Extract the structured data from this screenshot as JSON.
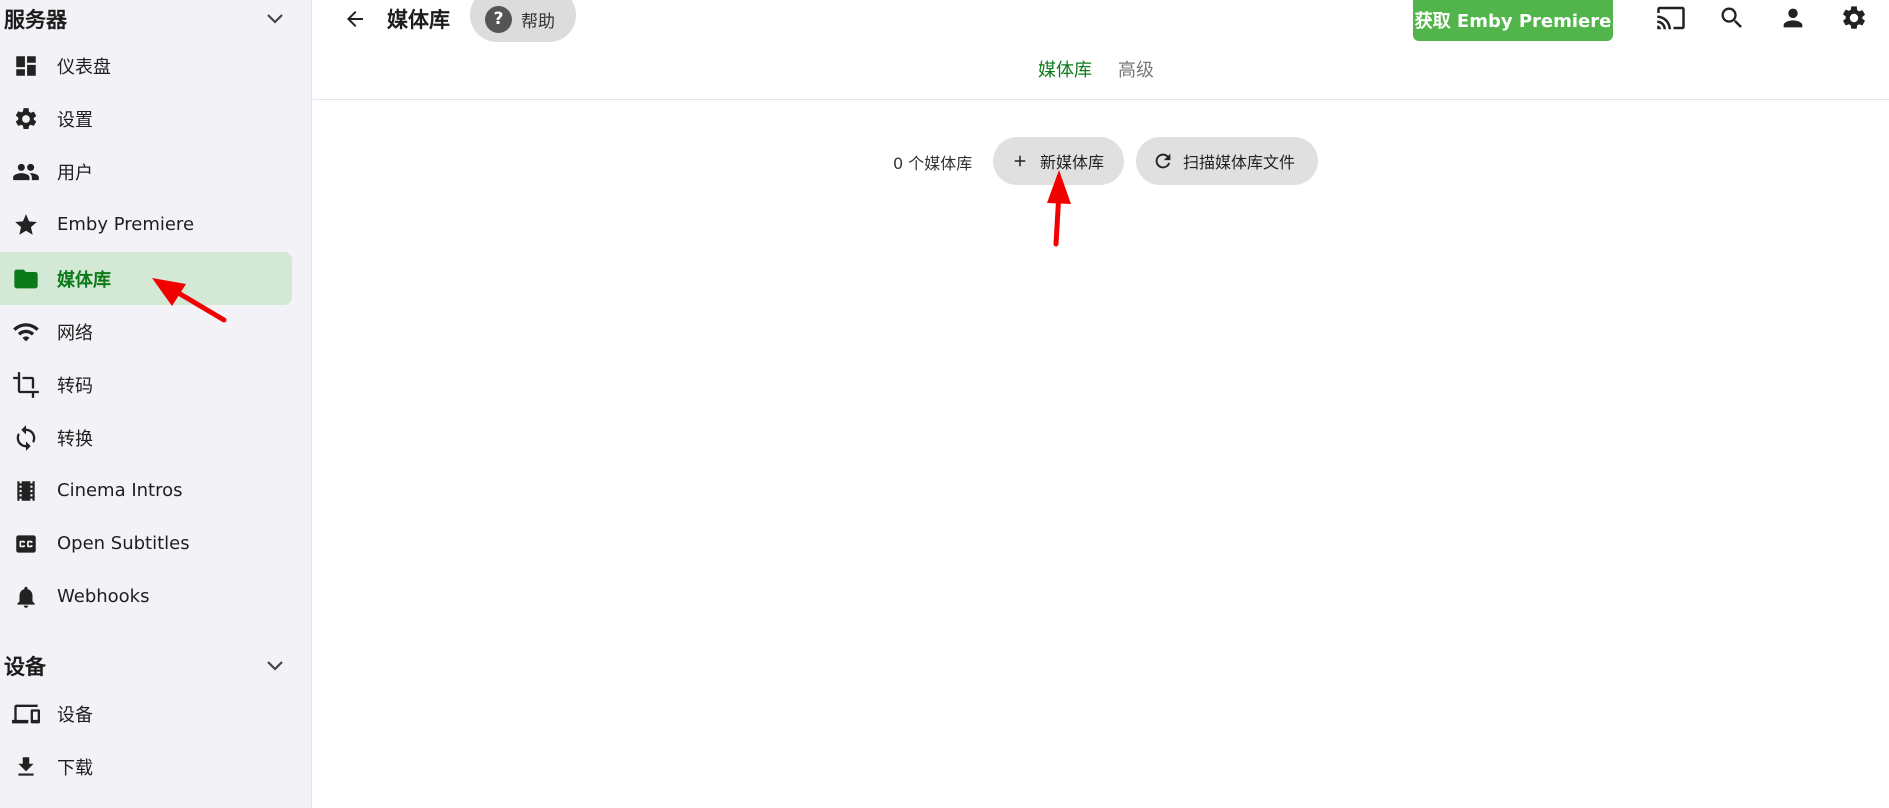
{
  "sidebar": {
    "sections": [
      {
        "title": "服务器",
        "items": [
          {
            "label": "仪表盘",
            "icon": "dashboard-icon"
          },
          {
            "label": "设置",
            "icon": "gear-icon"
          },
          {
            "label": "用户",
            "icon": "people-icon"
          },
          {
            "label": "Emby Premiere",
            "icon": "star-icon"
          },
          {
            "label": "媒体库",
            "icon": "folder-icon",
            "active": true
          },
          {
            "label": "网络",
            "icon": "wifi-icon"
          },
          {
            "label": "转码",
            "icon": "crop-icon"
          },
          {
            "label": "转换",
            "icon": "sync-icon"
          },
          {
            "label": "Cinema Intros",
            "icon": "film-icon"
          },
          {
            "label": "Open Subtitles",
            "icon": "cc-icon"
          },
          {
            "label": "Webhooks",
            "icon": "bell-icon"
          }
        ]
      },
      {
        "title": "设备",
        "items": [
          {
            "label": "设备",
            "icon": "devices-icon"
          },
          {
            "label": "下载",
            "icon": "download-icon"
          }
        ]
      }
    ]
  },
  "header": {
    "title": "媒体库",
    "help_label": "帮助",
    "premiere_label": "获取 Emby Premiere",
    "icons": [
      "cast-icon",
      "search-icon",
      "user-icon",
      "settings-icon"
    ]
  },
  "tabs": [
    {
      "label": "媒体库",
      "active": true
    },
    {
      "label": "高级",
      "active": false
    }
  ],
  "toolbar": {
    "count_text": "0 个媒体库",
    "new_library_label": "新媒体库",
    "scan_label": "扫描媒体库文件"
  },
  "colors": {
    "accent": "#0d7a1a",
    "active_bg": "#d4e8d6",
    "premiere_green": "#52b54b",
    "annotation_red": "#f20000"
  }
}
